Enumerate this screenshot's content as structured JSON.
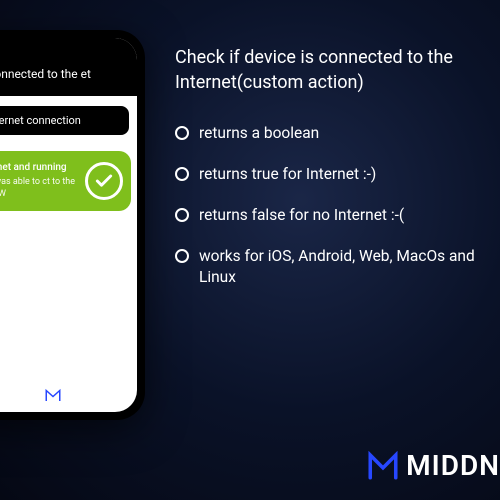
{
  "phone": {
    "header_text": "if connected to the et",
    "button_label": "Internet connection",
    "card": {
      "title": "iternet and running",
      "subtitle": "pp was able to ct to the WWW"
    }
  },
  "headline": "Check if device is connected to the Internet(custom action)",
  "bullets": [
    "returns a boolean",
    "returns true for Internet :-)",
    "returns false for no Internet :-(",
    "works for iOS, Android, Web, MacOs and Linux"
  ],
  "brand": {
    "name": "MIDDN"
  },
  "colors": {
    "accent_green": "#7FBF1C",
    "brand_blue": "#2747FF"
  }
}
